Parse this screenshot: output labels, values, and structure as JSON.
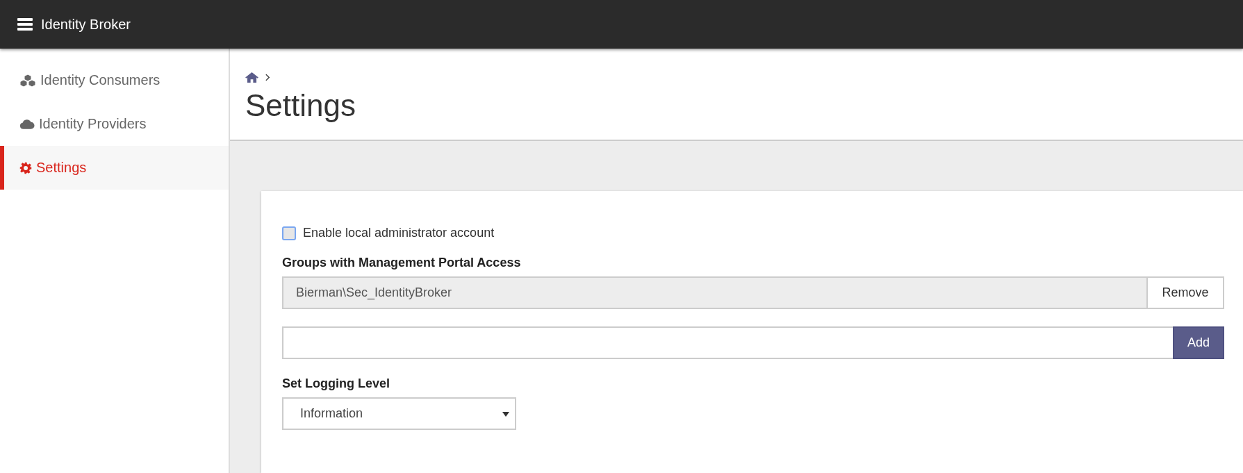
{
  "app_bar": {
    "title": "Identity Broker"
  },
  "sidebar": {
    "items": [
      {
        "label": "Identity Consumers",
        "kind": "cubes",
        "selected": false
      },
      {
        "label": "Identity Providers",
        "kind": "cloud",
        "selected": false
      },
      {
        "label": "Settings",
        "kind": "gear",
        "selected": true
      }
    ]
  },
  "page": {
    "title": "Settings"
  },
  "form": {
    "local_admin": {
      "label": "Enable local administrator account",
      "checked": false
    },
    "groups": {
      "label": "Groups with Management Portal Access",
      "entries": [
        {
          "value": "Bierman\\Sec_IdentityBroker",
          "action": "Remove"
        }
      ],
      "new_entry": {
        "action": "Add"
      }
    },
    "logging": {
      "label": "Set Logging Level",
      "value": "Information"
    }
  }
}
